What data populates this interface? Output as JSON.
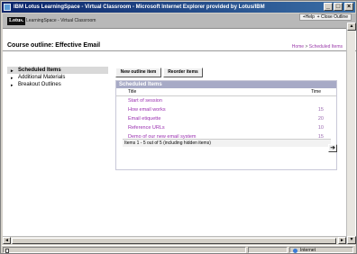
{
  "window": {
    "title": "IBM Lotus LearningSpace - Virtual Classroom - Microsoft Internet Explorer provided by Lotus/IBM",
    "minimize": "_",
    "maximize": "□",
    "close": "×"
  },
  "app_header": {
    "logo": "Lotus.",
    "product": "LearningSpace - Virtual Classroom",
    "help_link": "+Help",
    "close_outline_link": "+ Close Outline"
  },
  "outline_bar": {
    "title": "Course outline: Effective Email",
    "breadcrumb": [
      "Home",
      "Scheduled Items"
    ],
    "breadcrumb_sep": ">"
  },
  "left_nav": {
    "items": [
      {
        "label": "Scheduled Items",
        "bullet": "▸",
        "active": true
      },
      {
        "label": "Additional Materials",
        "bullet": "▸"
      },
      {
        "label": "Breakout Outlines",
        "bullet": "▸"
      }
    ]
  },
  "toolbar": {
    "new_outline_item": "New outline item",
    "reorder_items": "Reorder items"
  },
  "panel": {
    "header": "Scheduled Items",
    "columns": {
      "title": "Title",
      "time": "Time"
    },
    "rows": [
      {
        "title": "Start of session",
        "time": ""
      },
      {
        "title": "How email works",
        "time": "15"
      },
      {
        "title": "Email etiquette",
        "time": "20"
      },
      {
        "title": "Reference URLs",
        "time": "10"
      },
      {
        "title": "Demo of our new email system",
        "time": "15"
      }
    ],
    "footer": "Items 1 - 5 out of 5 (including hidden items)"
  },
  "next_button": "➜",
  "scroll": {
    "up": "▲",
    "down": "▼",
    "left": "◄",
    "right": "►"
  },
  "status": {
    "zone": "Internet"
  }
}
